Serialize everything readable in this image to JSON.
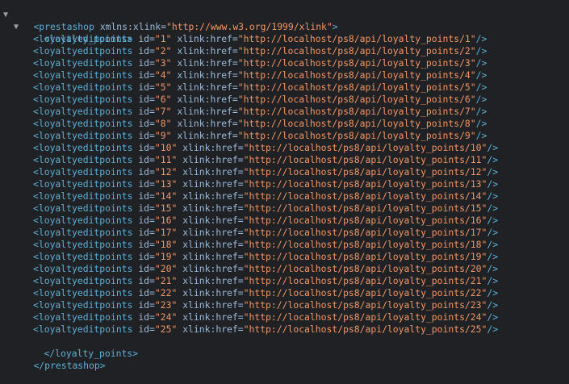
{
  "root": {
    "tag": "prestashop",
    "attr_name": "xmlns:xlink",
    "attr_value": "http://www.w3.org/1999/xlink",
    "toggle": "▼"
  },
  "container": {
    "tag": "loyalty_points",
    "toggle": "▼"
  },
  "item_tag": "loyaltyeditpoints",
  "item_id_attr": "id",
  "item_href_attr": "xlink:href",
  "items": [
    {
      "id": "1",
      "href": "http://localhost/ps8/api/loyalty_points/1"
    },
    {
      "id": "2",
      "href": "http://localhost/ps8/api/loyalty_points/2"
    },
    {
      "id": "3",
      "href": "http://localhost/ps8/api/loyalty_points/3"
    },
    {
      "id": "4",
      "href": "http://localhost/ps8/api/loyalty_points/4"
    },
    {
      "id": "5",
      "href": "http://localhost/ps8/api/loyalty_points/5"
    },
    {
      "id": "6",
      "href": "http://localhost/ps8/api/loyalty_points/6"
    },
    {
      "id": "7",
      "href": "http://localhost/ps8/api/loyalty_points/7"
    },
    {
      "id": "8",
      "href": "http://localhost/ps8/api/loyalty_points/8"
    },
    {
      "id": "9",
      "href": "http://localhost/ps8/api/loyalty_points/9"
    },
    {
      "id": "10",
      "href": "http://localhost/ps8/api/loyalty_points/10"
    },
    {
      "id": "11",
      "href": "http://localhost/ps8/api/loyalty_points/11"
    },
    {
      "id": "12",
      "href": "http://localhost/ps8/api/loyalty_points/12"
    },
    {
      "id": "13",
      "href": "http://localhost/ps8/api/loyalty_points/13"
    },
    {
      "id": "14",
      "href": "http://localhost/ps8/api/loyalty_points/14"
    },
    {
      "id": "15",
      "href": "http://localhost/ps8/api/loyalty_points/15"
    },
    {
      "id": "16",
      "href": "http://localhost/ps8/api/loyalty_points/16"
    },
    {
      "id": "17",
      "href": "http://localhost/ps8/api/loyalty_points/17"
    },
    {
      "id": "18",
      "href": "http://localhost/ps8/api/loyalty_points/18"
    },
    {
      "id": "19",
      "href": "http://localhost/ps8/api/loyalty_points/19"
    },
    {
      "id": "20",
      "href": "http://localhost/ps8/api/loyalty_points/20"
    },
    {
      "id": "21",
      "href": "http://localhost/ps8/api/loyalty_points/21"
    },
    {
      "id": "22",
      "href": "http://localhost/ps8/api/loyalty_points/22"
    },
    {
      "id": "23",
      "href": "http://localhost/ps8/api/loyalty_points/23"
    },
    {
      "id": "24",
      "href": "http://localhost/ps8/api/loyalty_points/24"
    },
    {
      "id": "25",
      "href": "http://localhost/ps8/api/loyalty_points/25"
    }
  ],
  "colors": {
    "background": "#202124",
    "tag": "#5db0d7",
    "attr_name": "#9bbbdc",
    "attr_value": "#f29766",
    "toggle": "#9aa0a6"
  }
}
